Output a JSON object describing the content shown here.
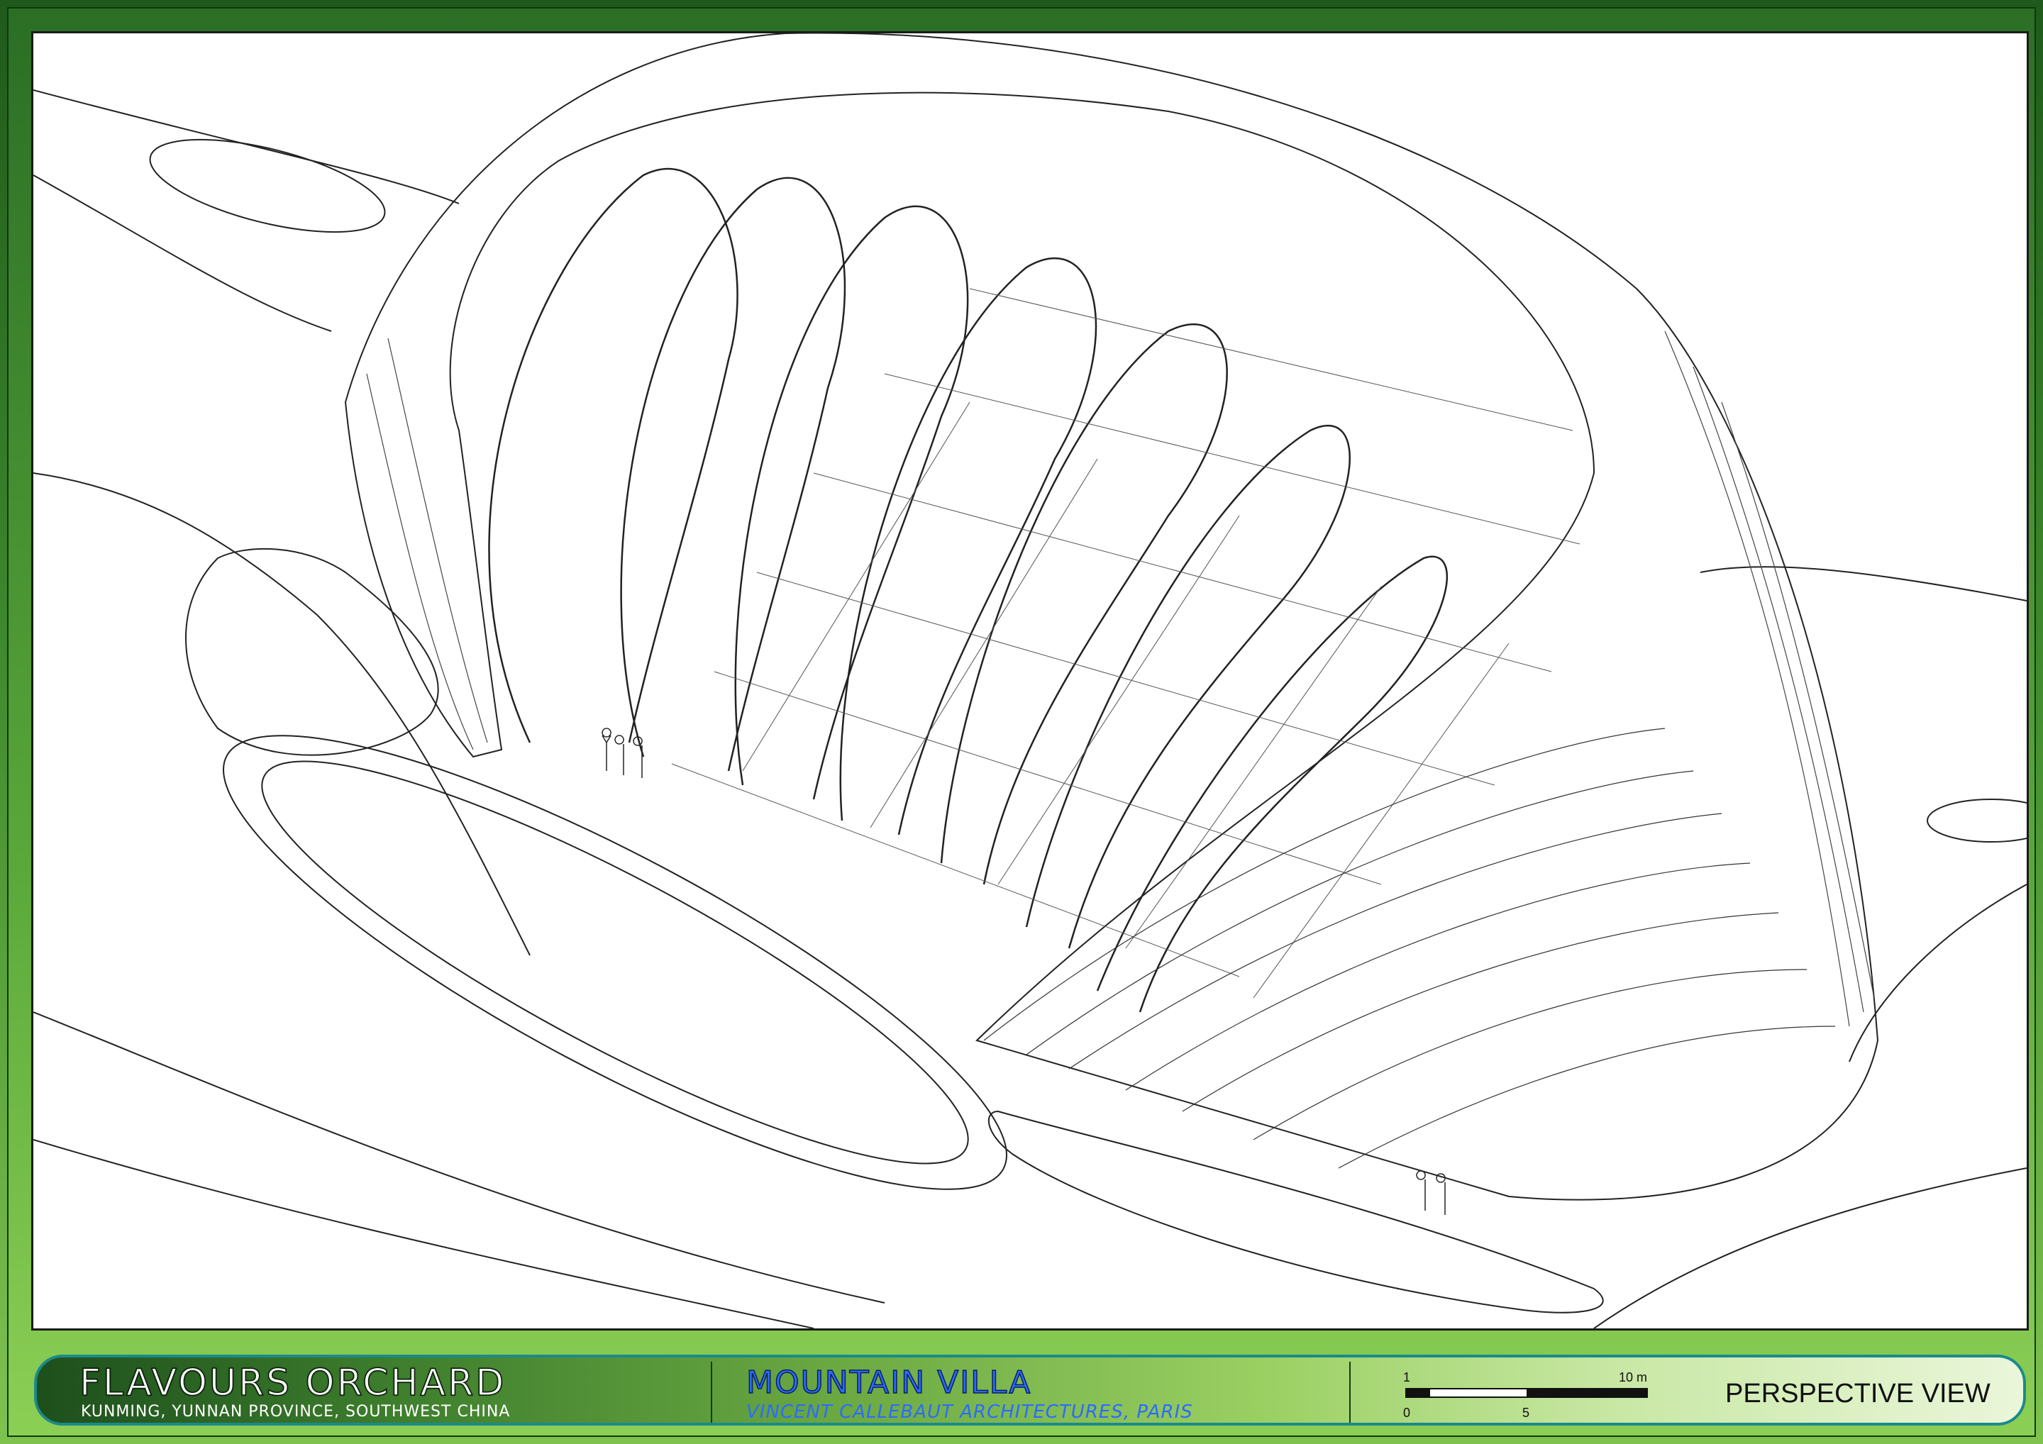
{
  "project": {
    "title": "FLAVOURS ORCHARD",
    "location": "KUNMING, YUNNAN PROVINCE, SOUTHWEST CHINA"
  },
  "building": {
    "name": "MOUNTAIN VILLA",
    "architect": "VINCENT CALLEBAUT ARCHITECTURES, PARIS"
  },
  "scale": {
    "label_1": "1",
    "label_10m": "10 m",
    "label_0": "0",
    "label_5": "5"
  },
  "view": {
    "label": "PERSPECTIVE VIEW"
  },
  "colors": {
    "frame_dark": "#1f5a1c",
    "frame_light": "#8ccf55",
    "title_accent": "#2a6cff",
    "border_teal": "#1b8a8a"
  }
}
